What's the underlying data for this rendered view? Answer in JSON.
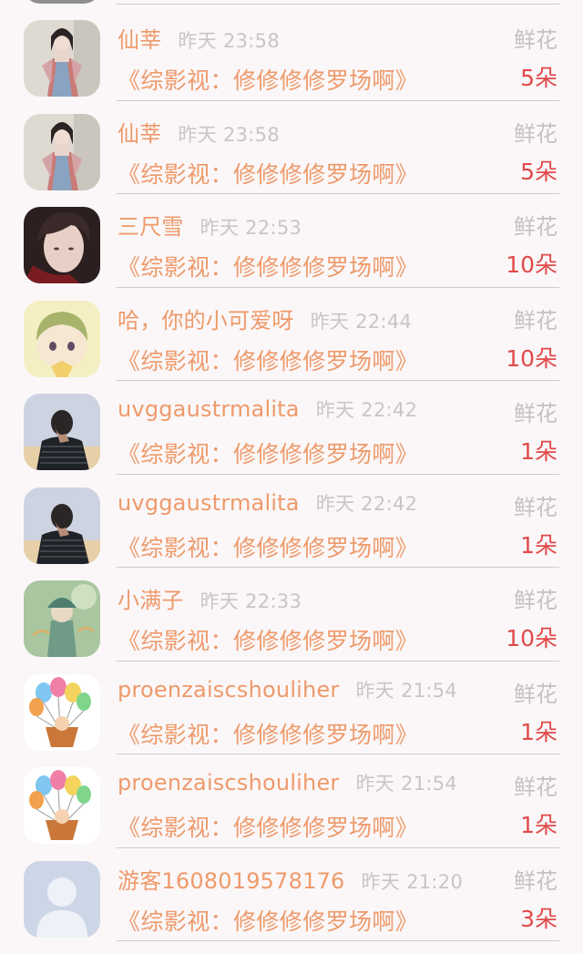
{
  "gift_records": [
    {
      "user": "仙莘",
      "time": "昨天 23:58",
      "gift": "鲜花",
      "book": "《综影视：修修修修罗场啊》",
      "count": "5朵",
      "avatar": "avatar-hanfu-woman"
    },
    {
      "user": "仙莘",
      "time": "昨天 23:58",
      "gift": "鲜花",
      "book": "《综影视：修修修修罗场啊》",
      "count": "5朵",
      "avatar": "avatar-hanfu-woman"
    },
    {
      "user": "三尺雪",
      "time": "昨天 22:53",
      "gift": "鲜花",
      "book": "《综影视：修修修修罗场啊》",
      "count": "10朵",
      "avatar": "avatar-man-portrait"
    },
    {
      "user": "哈，你的小可爱呀",
      "time": "昨天 22:44",
      "gift": "鲜花",
      "book": "《综影视：修修修修罗场啊》",
      "count": "10朵",
      "avatar": "avatar-anime-baby"
    },
    {
      "user": "uvggaustrmalita",
      "time": "昨天 22:42",
      "gift": "鲜花",
      "book": "《综影视：修修修修罗场啊》",
      "count": "1朵",
      "avatar": "avatar-boy-night"
    },
    {
      "user": "uvggaustrmalita",
      "time": "昨天 22:42",
      "gift": "鲜花",
      "book": "《综影视：修修修修罗场啊》",
      "count": "1朵",
      "avatar": "avatar-boy-night"
    },
    {
      "user": "小满子",
      "time": "昨天 22:33",
      "gift": "鲜花",
      "book": "《综影视：修修修修罗场啊》",
      "count": "10朵",
      "avatar": "avatar-green-illustration"
    },
    {
      "user": "proenzaiscshouliher",
      "time": "昨天 21:54",
      "gift": "鲜花",
      "book": "《综影视：修修修修罗场啊》",
      "count": "1朵",
      "avatar": "avatar-balloons"
    },
    {
      "user": "proenzaiscshouliher",
      "time": "昨天 21:54",
      "gift": "鲜花",
      "book": "《综影视：修修修修罗场啊》",
      "count": "1朵",
      "avatar": "avatar-balloons"
    },
    {
      "user": "游客1608019578176",
      "time": "昨天 21:20",
      "gift": "鲜花",
      "book": "《综影视：修修修修罗场啊》",
      "count": "3朵",
      "avatar": "avatar-default-user"
    }
  ],
  "colors": {
    "accent": "#ee9a6b",
    "count": "#e04a4a",
    "muted": "#c5c0c1",
    "background": "#fbf7f8"
  }
}
